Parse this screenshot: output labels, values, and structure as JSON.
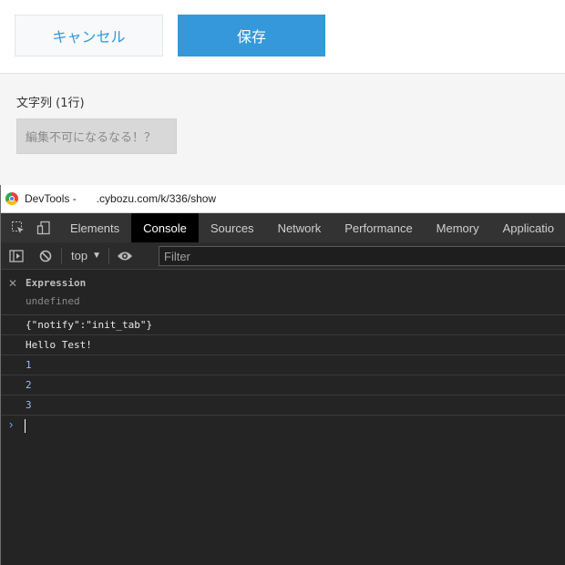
{
  "actions": {
    "cancel_label": "キャンセル",
    "save_label": "保存"
  },
  "form": {
    "field_label": "文字列 (1行)",
    "field_value": "編集不可になるなる！？"
  },
  "devtools": {
    "window_title": "DevTools -",
    "url": ".cybozu.com/k/336/show",
    "tabs": [
      "Elements",
      "Console",
      "Sources",
      "Network",
      "Performance",
      "Memory",
      "Applicatio"
    ],
    "active_tab": "Console",
    "context": "top",
    "filter_placeholder": "Filter",
    "expression": {
      "label": "Expression",
      "value": "undefined"
    },
    "log": [
      {
        "text": "{\"notify\":\"init_tab\"}",
        "type": "string"
      },
      {
        "text": "Hello Test!",
        "type": "string"
      },
      {
        "text": "1",
        "type": "number"
      },
      {
        "text": "2",
        "type": "number"
      },
      {
        "text": "3",
        "type": "number"
      }
    ],
    "icons": [
      "inspect-icon",
      "device-toolbar-icon",
      "sidebar-toggle-icon",
      "clear-console-icon",
      "eye-icon",
      "close-icon",
      "prompt-chevron-icon"
    ]
  }
}
